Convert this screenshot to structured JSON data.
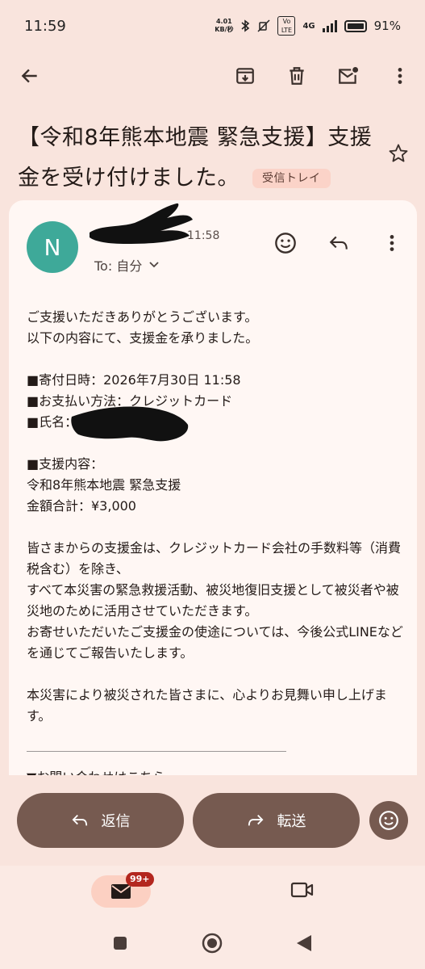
{
  "status": {
    "time": "11:59",
    "speed_value": "4.01",
    "speed_unit": "KB/秒",
    "network": "4G",
    "volte": "Vo LTE",
    "battery": "91",
    "battery_suffix": "%"
  },
  "email": {
    "subject": "【令和8年熊本地震 緊急支援】支援金を受け付けました。",
    "label": "受信トレイ",
    "sender_initial": "N",
    "time": "11:58",
    "to": "To: 自分",
    "body": {
      "greeting1": "ご支援いただきありがとうございます。",
      "greeting2": "以下の内容にて、支援金を承りました。",
      "date_line": "■寄付日時：2026年7月30日 11:58",
      "payment_line": "■お支払い方法：クレジットカード",
      "name_label": "■氏名：",
      "support_heading": "■支援内容：",
      "support_item": "令和8年熊本地震 緊急支援",
      "total": "金額合計：¥3,000",
      "para1": "皆さまからの支援金は、クレジットカード会社の手数料等（消費税含む）を除き、",
      "para2": "すべて本災害の緊急救援活動、被災地復旧支援として被災者や被災地のために活用させていただきます。",
      "para3": "お寄せいただいたご支援金の使途については、今後公式LINEなどを通じてご報告いたします。",
      "closing": "本災害により被災された皆さまに、心よりお見舞い申し上げます。",
      "divider": "＿＿＿＿＿＿＿＿＿＿＿＿＿＿＿＿＿＿＿＿＿＿＿",
      "contact": "▼お問い合わせはこちら"
    }
  },
  "actions": {
    "reply": "返信",
    "forward": "転送"
  },
  "nav": {
    "mail_badge": "99+"
  }
}
